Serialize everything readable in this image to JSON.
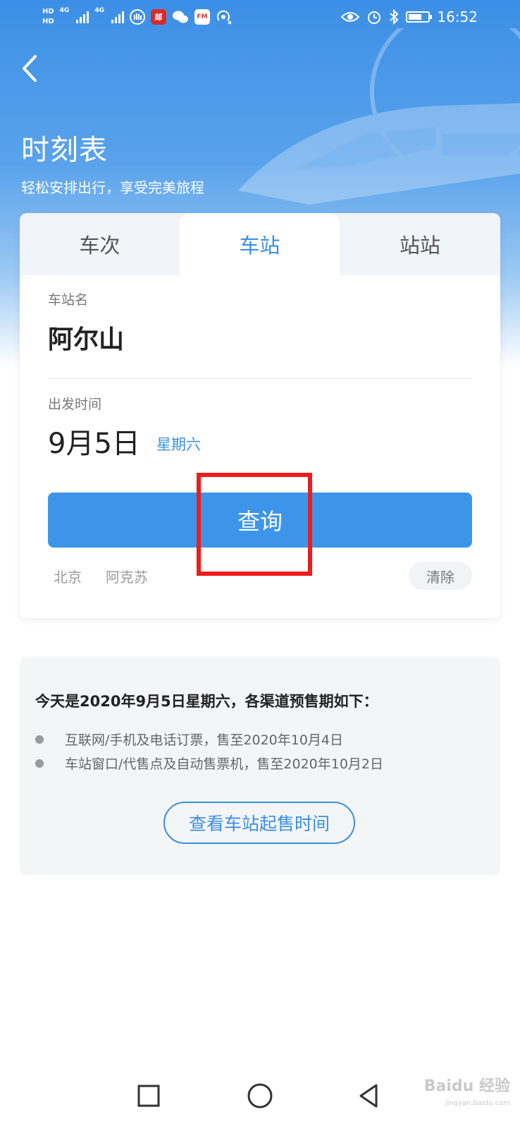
{
  "status_bar": {
    "hd1": "HD",
    "hd2": "HD",
    "net1": "4G",
    "net2": "4G",
    "time": "16:52",
    "app_mail_label": "邮",
    "app_fm_label": "FM",
    "icons": [
      "signal-icon",
      "hand-icon",
      "mail-app-icon",
      "wechat-icon",
      "fm-icon",
      "hotspot-icon",
      "eye-icon",
      "alarm-icon",
      "bluetooth-icon",
      "battery-icon"
    ]
  },
  "header": {
    "title": "时刻表",
    "subtitle": "轻松安排出行，享受完美旅程"
  },
  "tabs": [
    {
      "label": "车次",
      "active": false
    },
    {
      "label": "车站",
      "active": true
    },
    {
      "label": "站站",
      "active": false
    }
  ],
  "form": {
    "station_label": "车站名",
    "station_value": "阿尔山",
    "date_label": "出发时间",
    "date_value": "9月5日",
    "weekday": "星期六",
    "query_button": "查询"
  },
  "history": {
    "items": [
      "北京",
      "阿克苏"
    ],
    "clear_label": "清除"
  },
  "presale": {
    "title": "今天是2020年9月5日星期六，各渠道预售期如下：",
    "items": [
      "互联网/手机及电话订票，售至2020年10月4日",
      "车站窗口/代售点及自动售票机，售至2020年10月2日"
    ],
    "button": "查看车站起售时间"
  },
  "watermark": {
    "brand": "Baidu 经验",
    "url": "jingyan.baidu.com"
  },
  "colors": {
    "accent": "#3b8fe0",
    "button": "#3d95ea",
    "highlight": "#ee1c1c",
    "header_gradient_top": "#3c8fe6"
  }
}
